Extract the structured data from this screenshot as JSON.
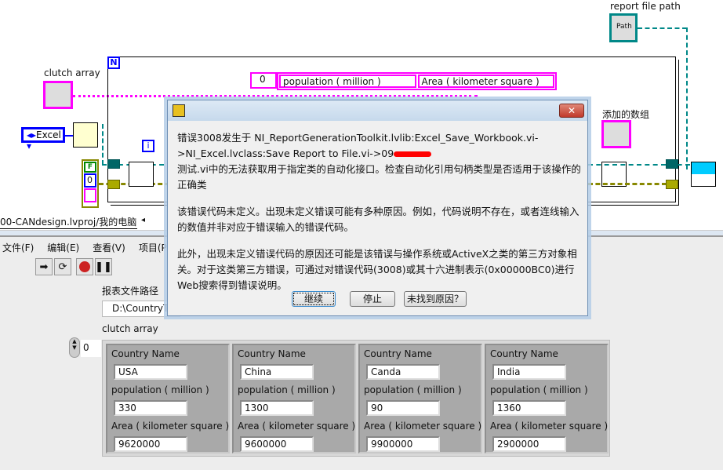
{
  "block_diagram": {
    "clutch_array_label": "clutch array",
    "excel_enum": "Excel",
    "report_file_path_label": "report file path",
    "path_terminal": "Path",
    "added_array_label": "添加的数组",
    "loop_count": "N",
    "loop_index": "i",
    "bool_const": "F",
    "num_const": "0",
    "array_index": "0",
    "header_cells": [
      "population ( million )",
      "Area ( kilometer square )"
    ]
  },
  "project_path": "00-CANdesign.lvproj/我的电脑",
  "menu": [
    "文件(F)",
    "编辑(E)",
    "查看(V)",
    "项目(P)"
  ],
  "toolbar": {
    "run": "run-arrow-icon",
    "continuous": "run-continuous-icon",
    "abort": "abort-icon",
    "pause": "pause-icon"
  },
  "front_panel": {
    "report_path_label": "报表文件路径",
    "report_path_value": "D:\\CountryT",
    "clutch_array_label": "clutch array",
    "array_index": "0",
    "field_labels": {
      "name": "Country Name",
      "population": "population ( million )",
      "area": "Area ( kilometer square )"
    },
    "rows": [
      {
        "name": "USA",
        "population": "330",
        "area": "9620000"
      },
      {
        "name": "China",
        "population": "1300",
        "area": "9600000"
      },
      {
        "name": "Canda",
        "population": "90",
        "area": "9900000"
      },
      {
        "name": "India",
        "population": "1360",
        "area": "2900000"
      }
    ]
  },
  "dialog": {
    "line1": "错误3008发生于 NI_ReportGenerationToolkit.lvlib:Excel_Save_Workbook.vi-",
    "line2": ">NI_Excel.lvclass:Save Report to File.vi->09",
    "line3": "测试.vi中的无法获取用于指定类的自动化接口。检查自动化引用句柄类型是否适用于该操作的正确类",
    "para2": "该错误代码未定义。出现未定义错误可能有多种原因。例如，代码说明不存在，或者连线输入的数值并非对应于错误输入的错误代码。",
    "para3": "此外，出现未定义错误代码的原因还可能是该错误与操作系统或ActiveX之类的第三方对象相关。对于这类第三方错误，可通过对错误代码(3008)或其十六进制表示(0x00000BC0)进行Web搜索得到错误说明。",
    "buttons": {
      "continue": "继续",
      "stop": "停止",
      "not_found": "未找到原因？"
    }
  }
}
